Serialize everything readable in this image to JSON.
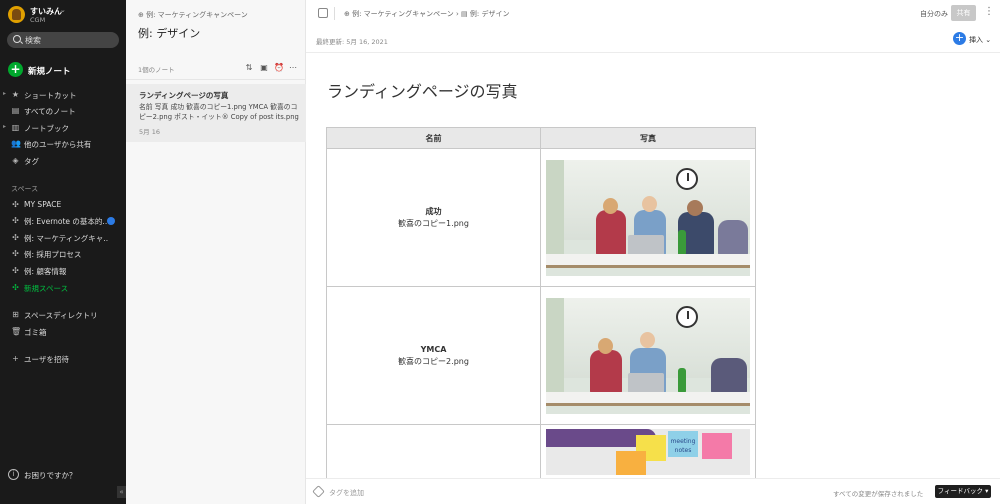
{
  "account": {
    "name": "すいみん",
    "sub": "CGM"
  },
  "sidebar": {
    "search_label": "検索",
    "new_note": "新規ノート",
    "nav": [
      {
        "label": "ショートカット",
        "icon": "star-icon"
      },
      {
        "label": "すべてのノート",
        "icon": "note-icon"
      },
      {
        "label": "ノートブック",
        "icon": "notebook-icon"
      },
      {
        "label": "他のユーザから共有",
        "icon": "people-icon"
      },
      {
        "label": "タグ",
        "icon": "tag-icon"
      }
    ],
    "spaces_label": "スペース",
    "spaces": [
      {
        "label": "MY SPACE"
      },
      {
        "label": "例: Evernote の基本的..."
      },
      {
        "label": "例: マーケティングキャ..."
      },
      {
        "label": "例: 採用プロセス"
      },
      {
        "label": "例: 顧客情報"
      },
      {
        "label": "新規スペース"
      }
    ],
    "directory": "スペースディレクトリ",
    "trash": "ゴミ箱",
    "invite": "ユーザを招待",
    "help": "お困りですか？"
  },
  "notelist": {
    "breadcrumb": "例: マーケティングキャンペーン",
    "title": "例: デザイン",
    "count": "1個のノート",
    "note": {
      "title": "ランディングページの写真",
      "snippet": "名前 写真 成功 歓喜のコピー1.png YMCA 歓喜のコピー2.png ポスト・イット® Copy of post its.png",
      "date": "5月 16"
    }
  },
  "editor": {
    "breadcrumb_space": "例: マーケティングキャンペーン",
    "breadcrumb_sep": "›",
    "breadcrumb_notebook": "例: デザイン",
    "only_me": "自分のみ",
    "share": "共有",
    "updated": "最終更新: 5月 16, 2021",
    "insert": "挿入",
    "title": "ランディングページの写真",
    "table": {
      "headers": [
        "名前",
        "写真"
      ],
      "rows": [
        {
          "name": "成功",
          "file": "歓喜のコピー1.png"
        },
        {
          "name": "YMCA",
          "file": "歓喜のコピー2.png"
        }
      ],
      "sticky_text": "meeting notes"
    },
    "tag_add": "タグを追加",
    "saved": "すべての変更が保存されました",
    "feedback": "フィードバック"
  }
}
